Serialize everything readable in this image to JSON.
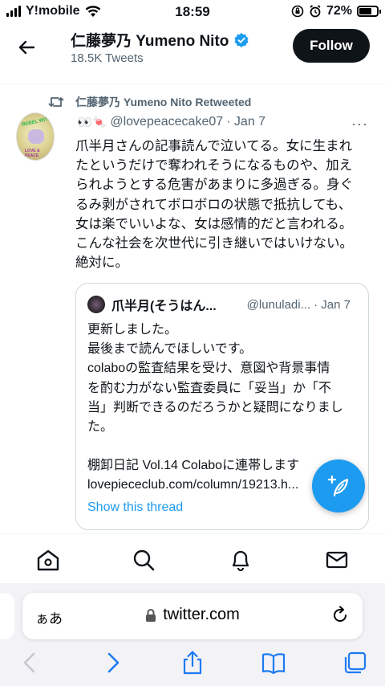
{
  "status_bar": {
    "carrier": "Y!mobile",
    "time": "18:59",
    "battery_percent": "72%",
    "battery_level": 0.72
  },
  "header": {
    "name": "仁藤夢乃 Yumeno Nito",
    "tweet_count": "18.5K Tweets",
    "follow_label": "Follow",
    "verified": true
  },
  "tweet": {
    "retweeted_by": "仁藤夢乃 Yumeno Nito Retweeted",
    "author_emoji": "👀🍬",
    "handle": "@lovepeacecake07",
    "date": "· Jan 7",
    "more": "···",
    "lines": [
      "爪半月さんの記事読んで泣いてる。女に生まれ",
      "たというだけで奪われそうになるものや、加え",
      "られようとする危害があまりに多過ぎる。身ぐ",
      "るみ剥がされてボロボロの状態で抵抗しても、",
      "女は楽でいいよな、女は感情的だと言われる。",
      "こんな社会を次世代に引き継いではいけない。",
      "絶対に。"
    ],
    "avatar_text_top": "REBEL WITH",
    "avatar_text_bottom": "LOVE & PEACE"
  },
  "quote": {
    "name": "爪半月(そうはん...",
    "handle": "@lunuladi...",
    "date": "· Jan 7",
    "lines": [
      "更新しました。",
      "最後まで読んでほしいです。",
      "colaboの監査結果を受け、意図や背景事情",
      "を酌む力がない監査委員に「妥当」か「不",
      "当」判断できるのだろうかと疑問になりまし",
      "た。",
      "",
      "棚卸日記 Vol.14 Colaboに連帯します",
      "lovepiececlub.com/column/19213.h..."
    ],
    "show_thread": "Show this thread"
  },
  "tabbar": {
    "items": [
      "home-icon",
      "search-icon",
      "notifications-icon",
      "messages-icon"
    ]
  },
  "safari": {
    "aa_label": "ぁあ",
    "url": "twitter.com"
  },
  "colors": {
    "accent": "#1d9bf0",
    "text": "#0f1419",
    "secondary": "#536471"
  }
}
